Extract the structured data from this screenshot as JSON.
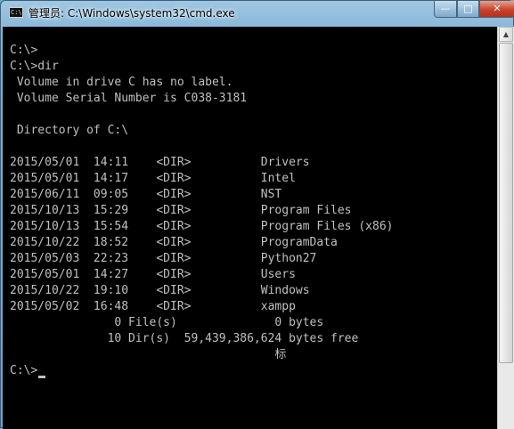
{
  "window": {
    "title": "管理员: C:\\Windows\\system32\\cmd.exe",
    "app_icon_text": "C:\\",
    "controls": {
      "minimize": "—",
      "maximize": "□",
      "close": "✕"
    }
  },
  "console": {
    "lines": [
      "",
      "C:\\>",
      "C:\\>dir",
      " Volume in drive C has no label.",
      " Volume Serial Number is C038-3181",
      "",
      " Directory of C:\\",
      "",
      "2015/05/01  14:11    <DIR>          Drivers",
      "2015/05/01  14:17    <DIR>          Intel",
      "2015/06/11  09:05    <DIR>          NST",
      "2015/10/13  15:29    <DIR>          Program Files",
      "2015/10/13  15:54    <DIR>          Program Files (x86)",
      "2015/10/22  18:52    <DIR>          ProgramData",
      "2015/05/03  22:23    <DIR>          Python27",
      "2015/05/01  14:27    <DIR>          Users",
      "2015/10/22  19:10    <DIR>          Windows",
      "2015/05/02  16:48    <DIR>          xampp",
      "               0 File(s)              0 bytes",
      "              10 Dir(s)  59,439,386,624 bytes free",
      "                                      标",
      "",
      "C:\\>"
    ]
  },
  "colors": {
    "console_background": "#000000",
    "console_text": "#c0c0c0",
    "close_button": "#c7432d"
  }
}
